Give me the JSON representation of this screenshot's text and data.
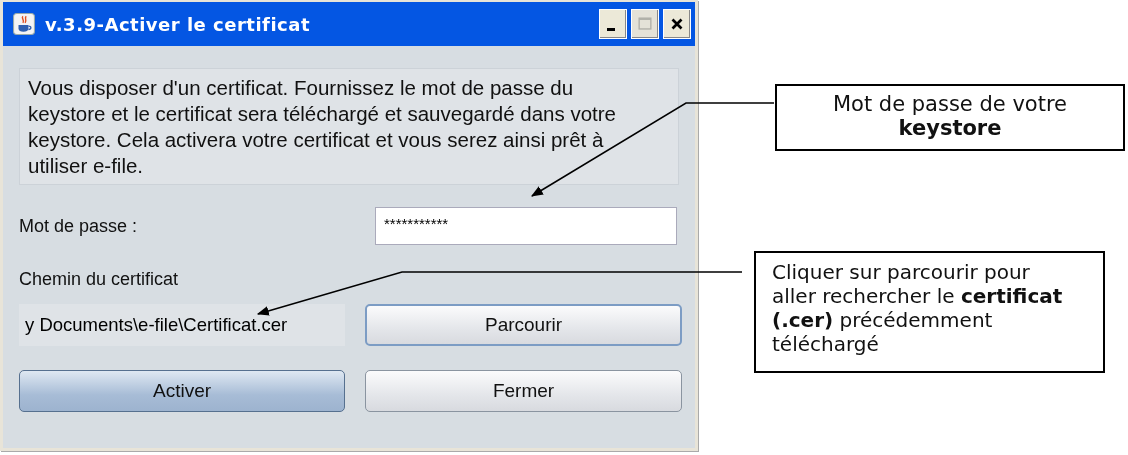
{
  "window": {
    "title": "v.3.9-Activer le certificat",
    "controls": [
      {
        "kind": "minimize",
        "disabled": false
      },
      {
        "kind": "maximize",
        "disabled": true
      },
      {
        "kind": "close",
        "disabled": false
      }
    ]
  },
  "message": "Vous disposer d'un certificat. Fournissez le mot de passe du keystore et le certificat sera téléchargé et sauvegardé dans votre keystore. Cela activera votre certificat et vous serez ainsi prêt à utiliser e-file.",
  "password": {
    "label": "Mot de passe :",
    "value": "***********"
  },
  "certificate": {
    "label": "Chemin du certificat",
    "path": "y Documents\\e-file\\Certificat.cer"
  },
  "browse_button": {
    "label": "Parcourir",
    "focused": true
  },
  "actions": [
    {
      "label": "Activer",
      "default": true
    },
    {
      "label": "Fermer",
      "default": false
    }
  ],
  "callouts": [
    {
      "text": "Mot de passe de votre **keystore**"
    },
    {
      "text": "Cliquer sur parcourir pour aller rechercher le **certificat (.cer)** précédemment téléchargé"
    }
  ]
}
